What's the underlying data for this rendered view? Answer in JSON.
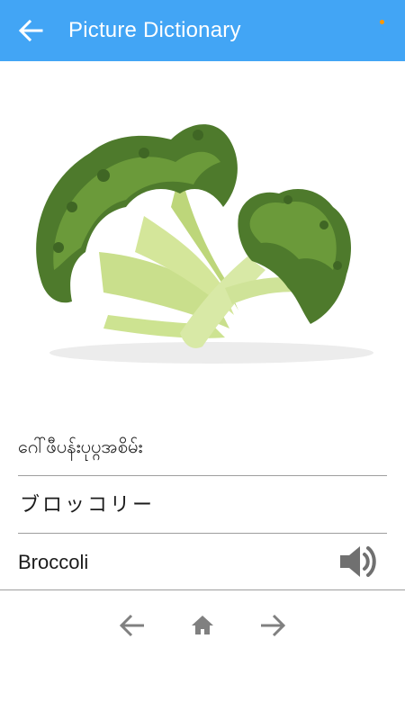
{
  "app": {
    "title": "Picture Dictionary",
    "accent_color": "#42a5f5",
    "overflow_dot_colors": [
      "#ff9800",
      "#42a5f5",
      "#42a5f5"
    ]
  },
  "entry": {
    "image_icon": "broccoli-image",
    "myanmar_word": "ဂေါ်ဖီပန်းပုပ္ဂအစိမ်း",
    "japanese_word": "ブロッコリー",
    "english_word": "Broccoli"
  },
  "icons": {
    "back": "arrow-left-icon",
    "overflow": "more-vert-icon",
    "speaker": "volume-icon",
    "prev": "arrow-left-icon",
    "home": "home-icon",
    "next": "arrow-right-icon"
  }
}
